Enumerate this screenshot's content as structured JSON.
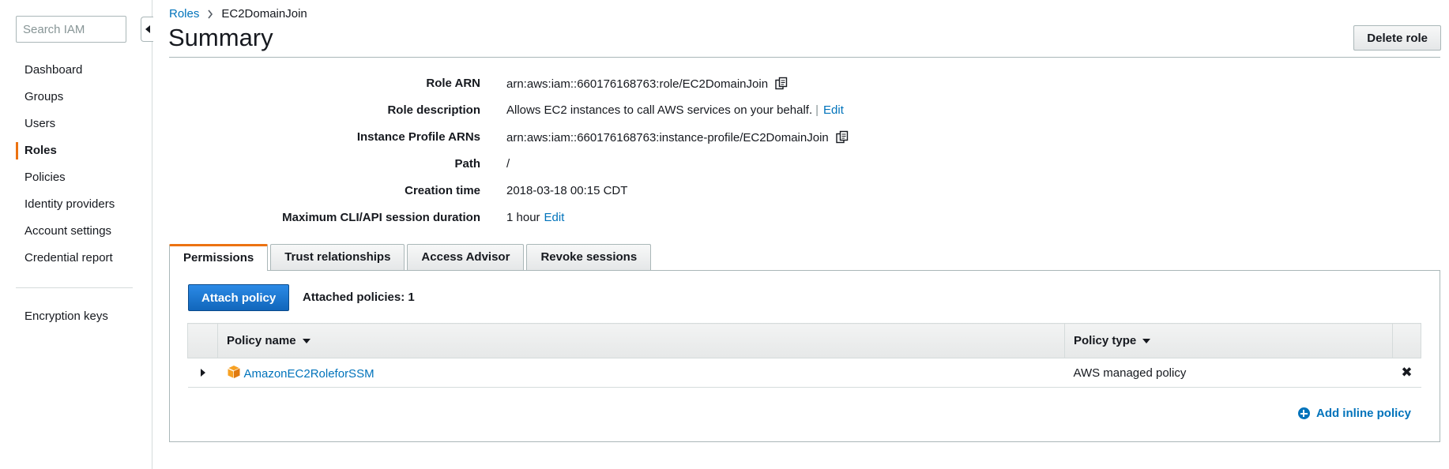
{
  "sidebar": {
    "search_placeholder": "Search IAM",
    "items": [
      {
        "label": "Dashboard"
      },
      {
        "label": "Groups"
      },
      {
        "label": "Users"
      },
      {
        "label": "Roles",
        "active": true
      },
      {
        "label": "Policies"
      },
      {
        "label": "Identity providers"
      },
      {
        "label": "Account settings"
      },
      {
        "label": "Credential report"
      }
    ],
    "bottom_items": [
      {
        "label": "Encryption keys"
      }
    ]
  },
  "breadcrumb": {
    "parent": "Roles",
    "current": "EC2DomainJoin"
  },
  "header": {
    "title": "Summary",
    "delete_label": "Delete role"
  },
  "summary": {
    "role_arn": {
      "label": "Role ARN",
      "value": "arn:aws:iam::660176168763:role/EC2DomainJoin"
    },
    "role_description": {
      "label": "Role description",
      "value": "Allows EC2 instances to call AWS services on your behalf.",
      "separator": "|",
      "edit": "Edit"
    },
    "instance_profile_arns": {
      "label": "Instance Profile ARNs",
      "value": "arn:aws:iam::660176168763:instance-profile/EC2DomainJoin"
    },
    "path": {
      "label": "Path",
      "value": "/"
    },
    "creation_time": {
      "label": "Creation time",
      "value": "2018-03-18 00:15 CDT"
    },
    "max_session": {
      "label": "Maximum CLI/API session duration",
      "value": "1 hour",
      "edit": "Edit"
    }
  },
  "tabs": [
    {
      "label": "Permissions",
      "active": true
    },
    {
      "label": "Trust relationships"
    },
    {
      "label": "Access Advisor"
    },
    {
      "label": "Revoke sessions"
    }
  ],
  "permissions": {
    "attach_label": "Attach policy",
    "attached_count": "Attached policies: 1",
    "columns": {
      "name": "Policy name",
      "type": "Policy type"
    },
    "rows": [
      {
        "name": "AmazonEC2RoleforSSM",
        "type": "AWS managed policy"
      }
    ],
    "add_inline_label": "Add inline policy"
  },
  "colors": {
    "accent": "#ec7211",
    "link": "#0073bb",
    "primary_button": "#1166bb"
  },
  "icons": {
    "copy": "copy-icon",
    "policy": "cube-icon",
    "remove": "close-icon",
    "add": "plus-circle-icon"
  }
}
